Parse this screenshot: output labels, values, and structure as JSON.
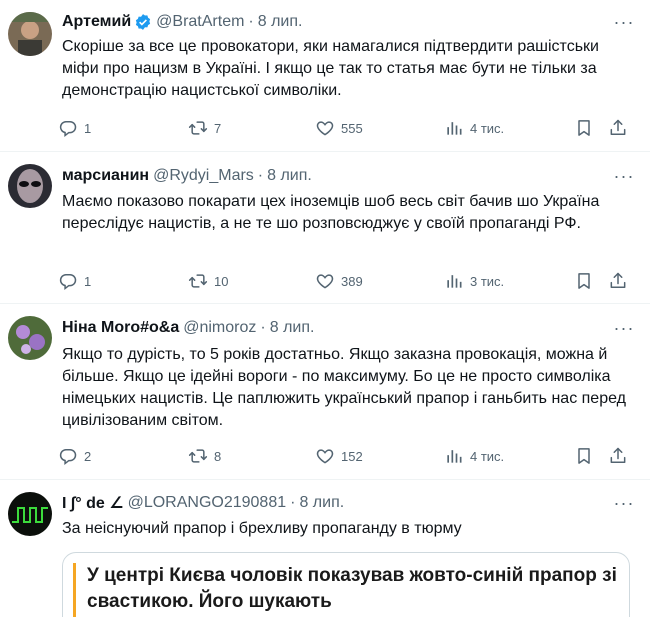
{
  "tweets": [
    {
      "name": "Артемий",
      "handle": "@BratArtem",
      "time": "8 лип.",
      "text": "Скоріше за все це провокатори, яки намагалися підтвердити рашістськи міфи про нацизм в Україні. І якщо це так то статья має бути не тільки за демонстрацію нацистської символіки.",
      "replies": "1",
      "reposts": "7",
      "likes": "555",
      "views": "4 тис."
    },
    {
      "name": "марсианин",
      "handle": "@Rydyi_Mars",
      "time": "8 лип.",
      "text": "Маємо показово покарати цех іноземців шоб весь світ бачив шо Україна переслідує нацистів, а не те шо розповсюджує у своїй пропаганді РФ.",
      "replies": "1",
      "reposts": "10",
      "likes": "389",
      "views": "3 тис."
    },
    {
      "name": "Ніна Моro#o&a",
      "handle": "@nimoroz",
      "time": "8 лип.",
      "text": "Якщо то дурість, то 5 років достатньо. Якщо заказна провокація, можна й більше. Якщо це ідейні вороги - по максимуму. Бо це не просто символіка німецьких нацистів. Це паплюжить український прапор і ганьбить нас перед цивілізованим світом.",
      "replies": "2",
      "reposts": "8",
      "likes": "152",
      "views": "4 тис."
    },
    {
      "name": "I ∫° de ∠",
      "handle": "@LORANGO2190881",
      "time": "8 лип.",
      "text": "За неіснуючий прапор і брехливу пропаганду  в тюрму"
    }
  ],
  "card": {
    "title": "У центрі Києва чоловік показував жовто-синій прапор зі свастикою. Його шукають"
  },
  "colors": {
    "verified": "#1d9bf0",
    "muted": "#536471",
    "card_accent": "#f5a623"
  }
}
